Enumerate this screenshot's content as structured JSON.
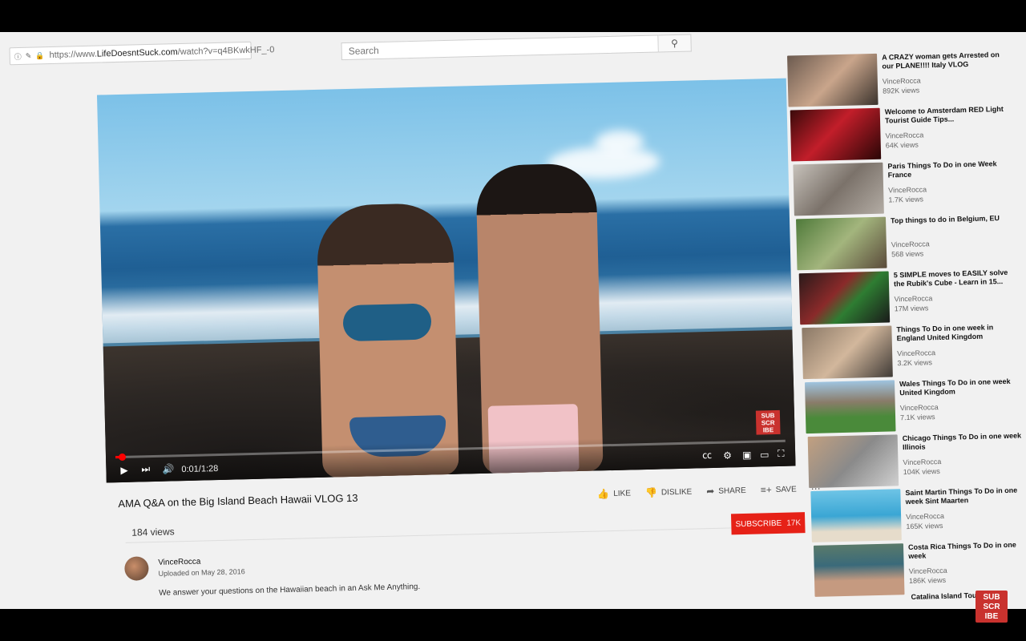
{
  "browser": {
    "url_prefix": "https://www.",
    "url_host": "LifeDoesntSuck.com",
    "url_path": "/watch?v=q4BKwkHF_-0",
    "search_placeholder": "Search"
  },
  "player": {
    "current_time": "0:01",
    "duration": "1:28",
    "progress": 0.01,
    "time_separator": " / ",
    "watermark": "SUB SCR IBE"
  },
  "video": {
    "title": "AMA Q&A on the Big Island Beach Hawaii VLOG 13",
    "views": "184 views",
    "actions": {
      "like": "LIKE",
      "dislike": "DISLIKE",
      "share": "SHARE",
      "save": "SAVE"
    },
    "channel": "VinceRocca",
    "uploaded": "Uploaded on May 28, 2016",
    "description": "We answer your questions on the Hawaiian beach in an Ask Me Anything.",
    "subscribe_label": "SUBSCRIBE",
    "subscriber_count": "17K"
  },
  "sidebar": {
    "items": [
      {
        "title": "A CRAZY woman gets Arrested on our PLANE!!!! Italy VLOG",
        "channel": "VinceRocca",
        "views": "892K views"
      },
      {
        "title": "Welcome to Amsterdam RED Light Tourist Guide Tips...",
        "channel": "VinceRocca",
        "views": "64K views"
      },
      {
        "title": "Paris Things To Do in one Week France",
        "channel": "VinceRocca",
        "views": "1.7K views"
      },
      {
        "title": "Top things to do in Belgium, EU",
        "channel": "VinceRocca",
        "views": "568 views"
      },
      {
        "title": "5 SIMPLE moves to EASILY solve the Rubik's Cube - Learn in 15...",
        "channel": "VinceRocca",
        "views": "17M views"
      },
      {
        "title": "Things To Do in one week in England United Kingdom",
        "channel": "VinceRocca",
        "views": "3.2K views"
      },
      {
        "title": "Wales Things To Do in one week United Kingdom",
        "channel": "VinceRocca",
        "views": "7.1K views"
      },
      {
        "title": "Chicago Things To Do in one week Illinois",
        "channel": "VinceRocca",
        "views": "104K views"
      },
      {
        "title": "Saint Martin Things To Do in one week Sint Maarten",
        "channel": "VinceRocca",
        "views": "165K views"
      },
      {
        "title": "Costa Rica Things To Do in one week",
        "channel": "VinceRocca",
        "views": "186K views"
      },
      {
        "title": "Catalina Island Tou",
        "channel": "",
        "views": ""
      }
    ]
  },
  "overlay": {
    "subscribe_badge": "SUB SCR IBE"
  }
}
